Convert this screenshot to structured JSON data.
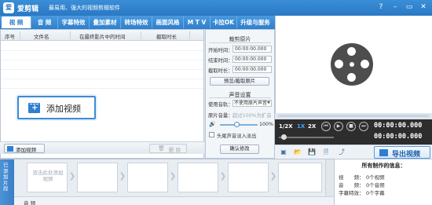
{
  "title_bar": {
    "logo_glyph": "爱",
    "app_name": "爱剪辑",
    "slogan": "最易用、强大的视频剪辑软件",
    "window_buttons": [
      "?",
      "–",
      "▭",
      "✕"
    ]
  },
  "tabs": [
    {
      "label": "视 频",
      "active": true
    },
    {
      "label": "音 频",
      "active": false
    },
    {
      "label": "字幕特效",
      "active": false
    },
    {
      "label": "叠加素材",
      "active": false
    },
    {
      "label": "转场特效",
      "active": false
    },
    {
      "label": "画面风格",
      "active": false
    },
    {
      "label": "M T V",
      "active": false
    },
    {
      "label": "卡拉OK",
      "active": false
    },
    {
      "label": "升级与服务",
      "active": false
    }
  ],
  "file_list": {
    "columns": [
      "序号",
      "文件名",
      "在最终影片中的时间",
      "截取时长"
    ],
    "callout_label": "添加视频",
    "add_button_label": "添加视频",
    "delete_button_label": "删 除"
  },
  "settings": {
    "clip_section_title": "裁剪原片",
    "start_label": "开始时间：",
    "start_value": "00:00:00.000",
    "end_label": "结束时间：",
    "end_value": "00:00:00.000",
    "duration_label": "截取时长：",
    "duration_value": "00:00:00.000",
    "preview_button": "预览/截取原片",
    "audio_section_title": "声音设置",
    "use_track_label": "使用音轨：",
    "use_track_value": "不使用原片声音",
    "volume_label": "原片音量：",
    "volume_hint": "超过100%为扩音",
    "volume_value": "100%",
    "volume_level": 0.5,
    "fade_label": "头尾声音淡入淡出",
    "confirm_button": "确认修改"
  },
  "player": {
    "speeds": [
      "1/2X",
      "1X",
      "2X"
    ],
    "selected_speed": "1X",
    "controls": [
      "prev-icon",
      "play-icon",
      "stop-icon",
      "next-icon"
    ],
    "time_current": "00:00:00.000",
    "time_total": "00:00:00.000",
    "export_label": "导出视频"
  },
  "timeline": {
    "sidebar_label": "已添加片段",
    "slot_hint": "双击此处添加视频",
    "audio_track_label": "音 频"
  },
  "info": {
    "title": "所有制作的信息：",
    "rows": [
      {
        "key": "视　　频：",
        "value": "0个视频"
      },
      {
        "key": "音　　频：",
        "value": "0个音频"
      },
      {
        "key": "字幕特效：",
        "value": "0个字幕"
      }
    ]
  },
  "colors": {
    "brand_blue": "#2a78c4",
    "accent_blue": "#45a7ff",
    "player_bg": "#2d2d2d"
  }
}
